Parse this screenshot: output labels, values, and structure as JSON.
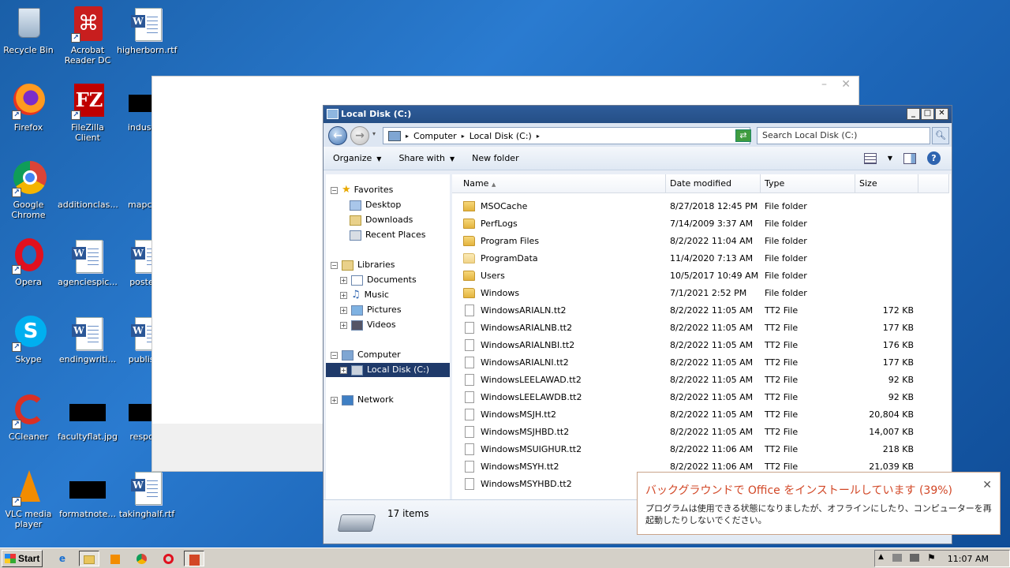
{
  "desktop": {
    "icons": [
      {
        "label": "Recycle Bin",
        "icon": "recycle-bin-icon"
      },
      {
        "label": "Acrobat Reader DC",
        "icon": "acrobat-icon"
      },
      {
        "label": "higherborn.rtf",
        "icon": "word-doc-icon"
      },
      {
        "label": "Firefox",
        "icon": "firefox-icon"
      },
      {
        "label": "FileZilla Client",
        "icon": "filezilla-icon"
      },
      {
        "label": "industria",
        "icon": "image-file-icon"
      },
      {
        "label": "Google Chrome",
        "icon": "chrome-icon"
      },
      {
        "label": "additionclas...",
        "icon": "image-file-icon"
      },
      {
        "label": "mapcom",
        "icon": "image-file-icon"
      },
      {
        "label": "Opera",
        "icon": "opera-icon"
      },
      {
        "label": "agenciespic...",
        "icon": "word-doc-icon"
      },
      {
        "label": "postedli",
        "icon": "word-doc-icon"
      },
      {
        "label": "Skype",
        "icon": "skype-icon"
      },
      {
        "label": "endingwriti...",
        "icon": "word-doc-icon"
      },
      {
        "label": "publishe",
        "icon": "word-doc-icon"
      },
      {
        "label": "CCleaner",
        "icon": "ccleaner-icon"
      },
      {
        "label": "facultyflat.jpg",
        "icon": "image-file-icon"
      },
      {
        "label": "respons",
        "icon": "image-file-icon"
      },
      {
        "label": "VLC media player",
        "icon": "vlc-icon"
      },
      {
        "label": "formatnote...",
        "icon": "image-file-icon"
      },
      {
        "label": "takinghalf.rtf",
        "icon": "word-doc-icon"
      }
    ]
  },
  "blank_window": {
    "min": "–",
    "close": "✕"
  },
  "explorer": {
    "title": "Local Disk (C:)",
    "window_buttons": {
      "min": "_",
      "max": "□",
      "close": "✕"
    },
    "breadcrumb": [
      "Computer",
      "Local Disk (C:)"
    ],
    "search_placeholder": "Search Local Disk (C:)",
    "toolbar": {
      "organize": "Organize",
      "share": "Share with",
      "new_folder": "New folder"
    },
    "nav": {
      "favorites": "Favorites",
      "desktop": "Desktop",
      "downloads": "Downloads",
      "recent": "Recent Places",
      "libraries": "Libraries",
      "documents": "Documents",
      "music": "Music",
      "pictures": "Pictures",
      "videos": "Videos",
      "computer": "Computer",
      "local_disk": "Local Disk (C:)",
      "network": "Network"
    },
    "columns": {
      "name": "Name",
      "date": "Date modified",
      "type": "Type",
      "size": "Size"
    },
    "files": [
      {
        "name": "MSOCache",
        "date": "8/27/2018 12:45 PM",
        "type": "File folder",
        "size": "",
        "kind": "locked-folder"
      },
      {
        "name": "PerfLogs",
        "date": "7/14/2009 3:37 AM",
        "type": "File folder",
        "size": "",
        "kind": "folder"
      },
      {
        "name": "Program Files",
        "date": "8/2/2022 11:04 AM",
        "type": "File folder",
        "size": "",
        "kind": "folder"
      },
      {
        "name": "ProgramData",
        "date": "11/4/2020 7:13 AM",
        "type": "File folder",
        "size": "",
        "kind": "hidden-folder"
      },
      {
        "name": "Users",
        "date": "10/5/2017 10:49 AM",
        "type": "File folder",
        "size": "",
        "kind": "folder"
      },
      {
        "name": "Windows",
        "date": "7/1/2021 2:52 PM",
        "type": "File folder",
        "size": "",
        "kind": "folder"
      },
      {
        "name": "WindowsARIALN.tt2",
        "date": "8/2/2022 11:05 AM",
        "type": "TT2 File",
        "size": "172 KB",
        "kind": "file"
      },
      {
        "name": "WindowsARIALNB.tt2",
        "date": "8/2/2022 11:05 AM",
        "type": "TT2 File",
        "size": "177 KB",
        "kind": "file"
      },
      {
        "name": "WindowsARIALNBI.tt2",
        "date": "8/2/2022 11:05 AM",
        "type": "TT2 File",
        "size": "176 KB",
        "kind": "file"
      },
      {
        "name": "WindowsARIALNI.tt2",
        "date": "8/2/2022 11:05 AM",
        "type": "TT2 File",
        "size": "177 KB",
        "kind": "file"
      },
      {
        "name": "WindowsLEELAWAD.tt2",
        "date": "8/2/2022 11:05 AM",
        "type": "TT2 File",
        "size": "92 KB",
        "kind": "file"
      },
      {
        "name": "WindowsLEELAWDB.tt2",
        "date": "8/2/2022 11:05 AM",
        "type": "TT2 File",
        "size": "92 KB",
        "kind": "file"
      },
      {
        "name": "WindowsMSJH.tt2",
        "date": "8/2/2022 11:05 AM",
        "type": "TT2 File",
        "size": "20,804 KB",
        "kind": "file"
      },
      {
        "name": "WindowsMSJHBD.tt2",
        "date": "8/2/2022 11:05 AM",
        "type": "TT2 File",
        "size": "14,007 KB",
        "kind": "file"
      },
      {
        "name": "WindowsMSUIGHUR.tt2",
        "date": "8/2/2022 11:06 AM",
        "type": "TT2 File",
        "size": "218 KB",
        "kind": "file"
      },
      {
        "name": "WindowsMSYH.tt2",
        "date": "8/2/2022 11:06 AM",
        "type": "TT2 File",
        "size": "21,039 KB",
        "kind": "file"
      },
      {
        "name": "WindowsMSYHBD.tt2",
        "date": "",
        "type": "",
        "size": "",
        "kind": "file"
      }
    ],
    "status": "17 items"
  },
  "notification": {
    "title": "バックグラウンドで Office をインストールしています (39%)",
    "body": "プログラムは使用できる状態になりましたが、オフラインにしたり、コンピューターを再起動したりしないでください。",
    "close": "✕",
    "progress_percent": 39
  },
  "taskbar": {
    "start": "Start",
    "clock": "11:07 AM"
  },
  "colors": {
    "notify_accent": "#d24726",
    "selection": "#1f3a6a"
  }
}
